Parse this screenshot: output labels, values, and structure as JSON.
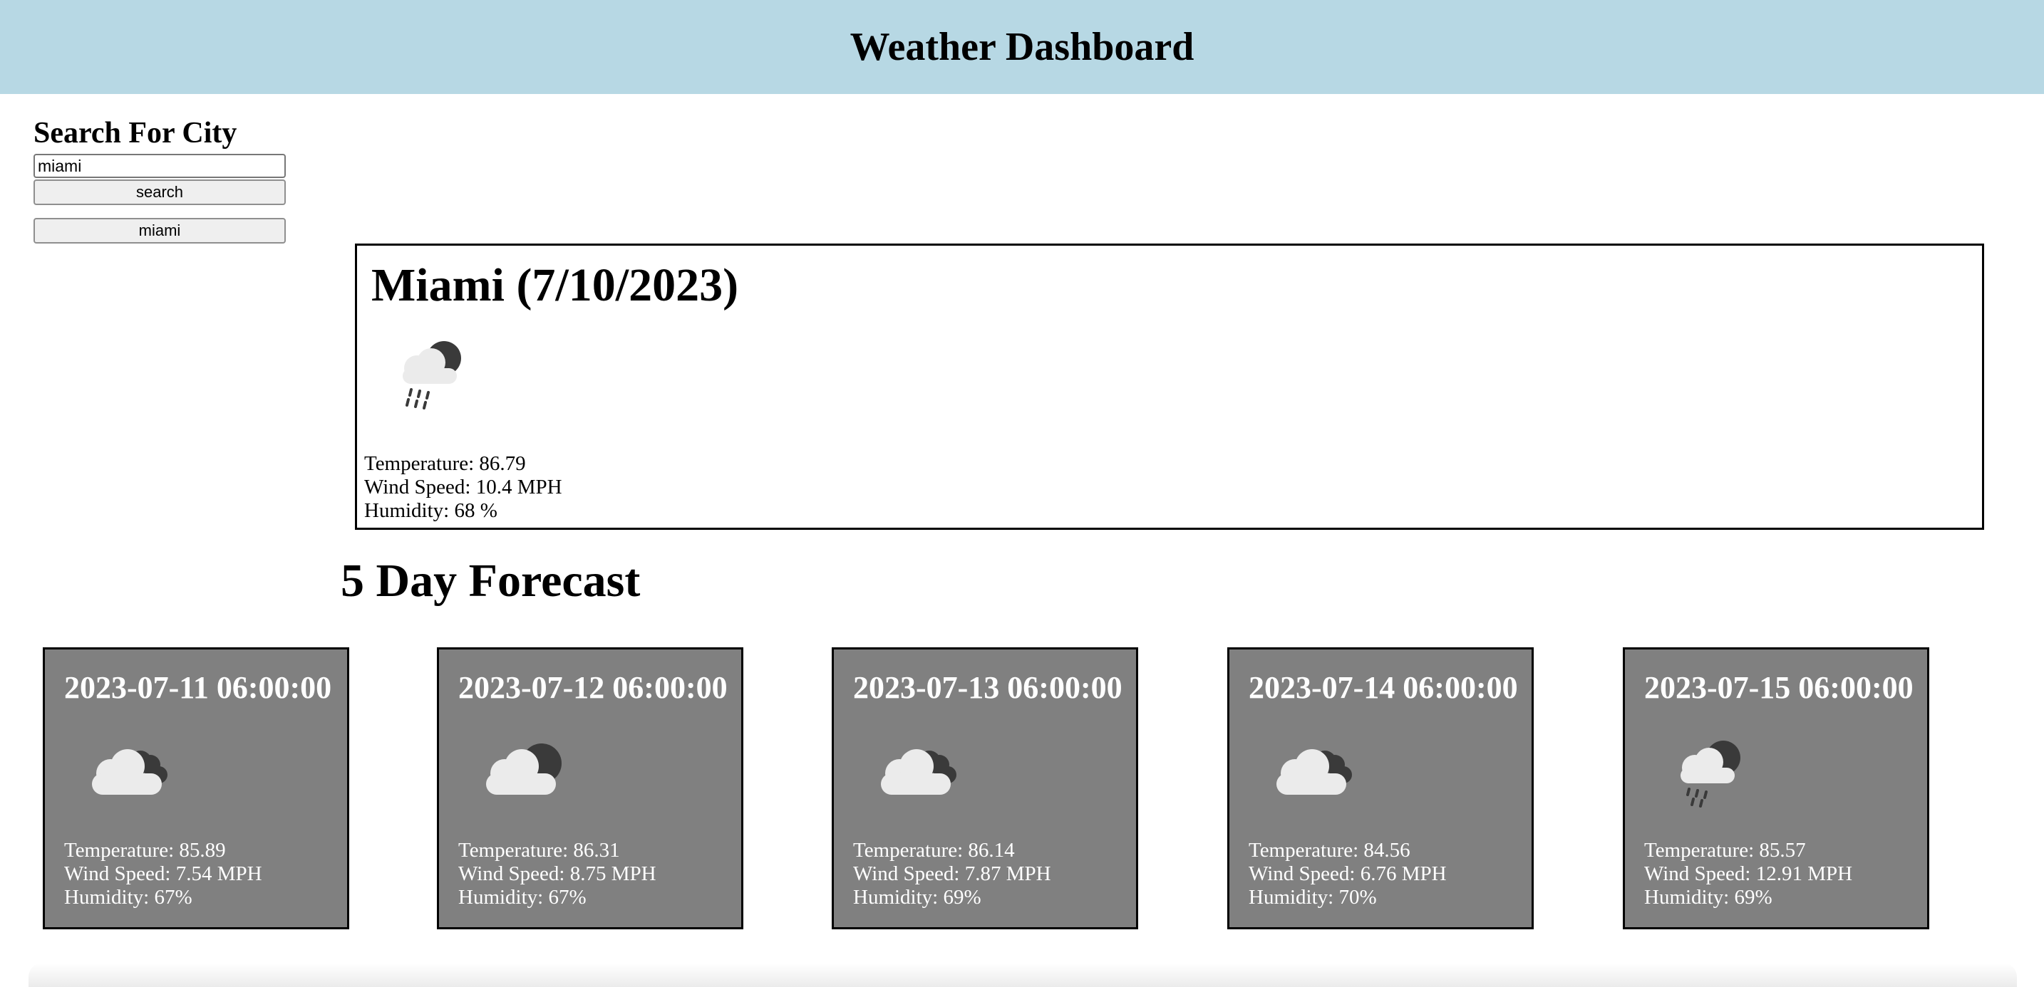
{
  "header": {
    "title": "Weather Dashboard"
  },
  "sidebar": {
    "heading": "Search For City",
    "search_value": "miami",
    "search_button": "search",
    "history": [
      "miami"
    ]
  },
  "current": {
    "title": "Miami (7/10/2023)",
    "icon": "rain-cloud-sun-icon",
    "temperature": "Temperature: 86.79",
    "wind": "Wind Speed: 10.4 MPH",
    "humidity": "Humidity: 68 %"
  },
  "forecast": {
    "title": "5 Day Forecast",
    "days": [
      {
        "date": "2023-07-11 06:00:00",
        "icon": "broken-clouds-icon",
        "temperature": "Temperature: 85.89",
        "wind": "Wind Speed: 7.54 MPH",
        "humidity": "Humidity: 67%"
      },
      {
        "date": "2023-07-12 06:00:00",
        "icon": "cloud-sun-icon",
        "temperature": "Temperature: 86.31",
        "wind": "Wind Speed: 8.75 MPH",
        "humidity": "Humidity: 67%"
      },
      {
        "date": "2023-07-13 06:00:00",
        "icon": "broken-clouds-icon",
        "temperature": "Temperature: 86.14",
        "wind": "Wind Speed: 7.87 MPH",
        "humidity": "Humidity: 69%"
      },
      {
        "date": "2023-07-14 06:00:00",
        "icon": "broken-clouds-icon",
        "temperature": "Temperature: 84.56",
        "wind": "Wind Speed: 6.76 MPH",
        "humidity": "Humidity: 70%"
      },
      {
        "date": "2023-07-15 06:00:00",
        "icon": "rain-cloud-sun-icon",
        "temperature": "Temperature: 85.57",
        "wind": "Wind Speed: 12.91 MPH",
        "humidity": "Humidity: 69%"
      }
    ]
  }
}
